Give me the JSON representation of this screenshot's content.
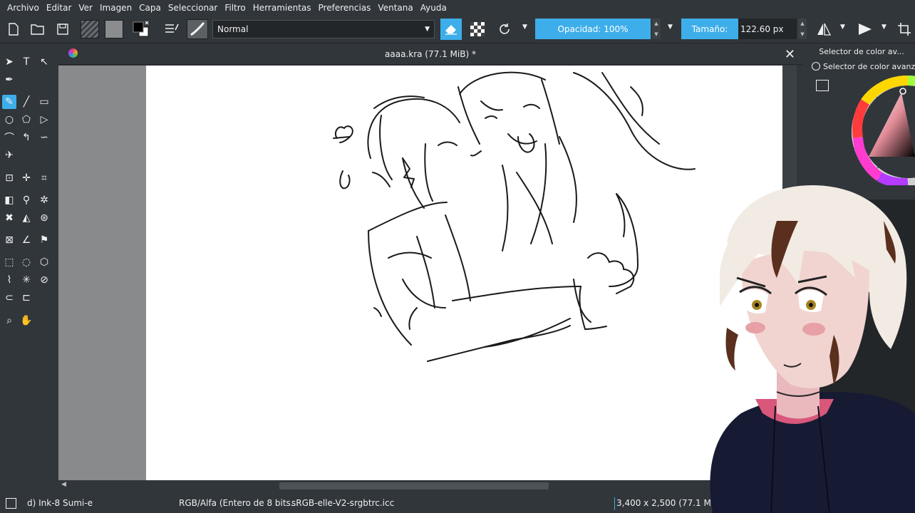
{
  "menu": [
    "Archivo",
    "Editar",
    "Ver",
    "Imagen",
    "Capa",
    "Seleccionar",
    "Filtro",
    "Herramientas",
    "Preferencias",
    "Ventana",
    "Ayuda"
  ],
  "toolbar": {
    "blend_mode": "Normal",
    "opacity_label": "Opacidad: 100%",
    "size_label": "Tamaño:",
    "size_value": "122.60 px"
  },
  "document": {
    "title": "aaaa.kra (77.1 MiB) *",
    "close_glyph": "✕"
  },
  "docker": {
    "title": "Selector de color av...",
    "tab_label": "Selector de color avanz"
  },
  "status": {
    "brush": "d) Ink-8 Sumi-e",
    "color_model": "RGB/Alfa (Entero de 8 bits...",
    "profile": "sRGB-elle-V2-srgbtrc.icc",
    "dimensions": "3,400 x 2,500 (77.1 M"
  },
  "colors": {
    "accent": "#3daee9",
    "panel": "#31363b",
    "canvas_bg": "#888a8c",
    "paper": "#ffffff",
    "overlay_hoodie": "#171a33",
    "overlay_skin": "#f1d4d0",
    "overlay_hair": "#f2ebe3",
    "overlay_hair_streak": "#5a2f1e"
  }
}
